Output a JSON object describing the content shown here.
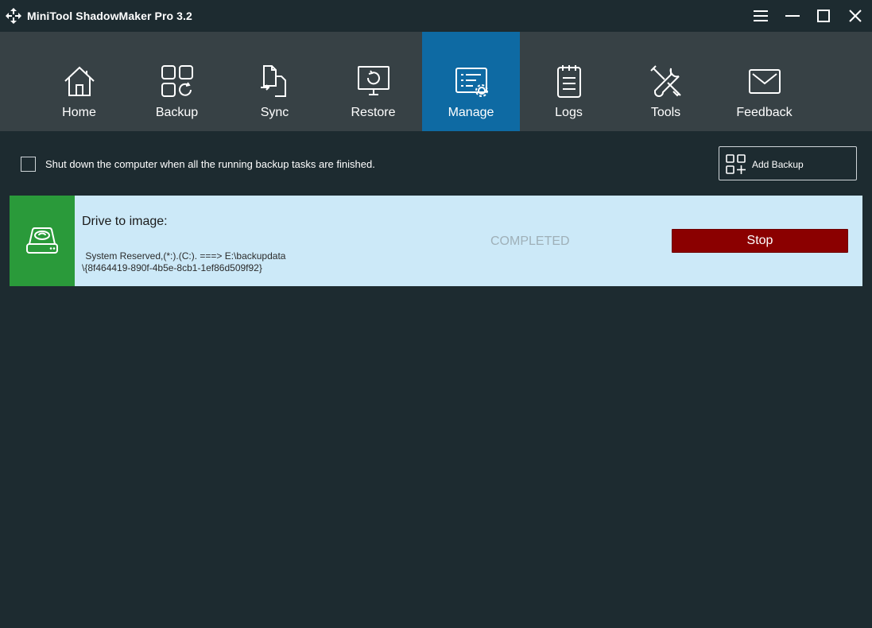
{
  "app": {
    "title": "MiniTool ShadowMaker Pro 3.2"
  },
  "window_controls": [
    "menu-icon",
    "minimize-icon",
    "maximize-icon",
    "close-icon"
  ],
  "nav": {
    "items": [
      {
        "label": "Home",
        "icon": "home-icon"
      },
      {
        "label": "Backup",
        "icon": "backup-icon"
      },
      {
        "label": "Sync",
        "icon": "sync-icon"
      },
      {
        "label": "Restore",
        "icon": "restore-icon"
      },
      {
        "label": "Manage",
        "icon": "manage-icon",
        "active": true
      },
      {
        "label": "Logs",
        "icon": "logs-icon"
      },
      {
        "label": "Tools",
        "icon": "tools-icon"
      },
      {
        "label": "Feedback",
        "icon": "feedback-icon"
      }
    ]
  },
  "manage": {
    "shutdown_label": "Shut down the computer when all the running backup tasks are finished.",
    "shutdown_checked": false,
    "add_backup_label": "Add Backup"
  },
  "task": {
    "title": "Drive to image:",
    "source_line": " System Reserved,(*:).(C:). ===> E:\\backupdata",
    "dest_line": "\\{8f464419-890f-4b5e-8cb1-1ef86d509f92}",
    "status": "COMPLETED",
    "stop_label": "Stop"
  },
  "colors": {
    "background": "#1d2b30",
    "navbar": "#374145",
    "active_tab": "#0e6aa3",
    "task_card": "#cce9f8",
    "task_icon_bg": "#2a9a3a",
    "stop_button": "#8b0000"
  }
}
